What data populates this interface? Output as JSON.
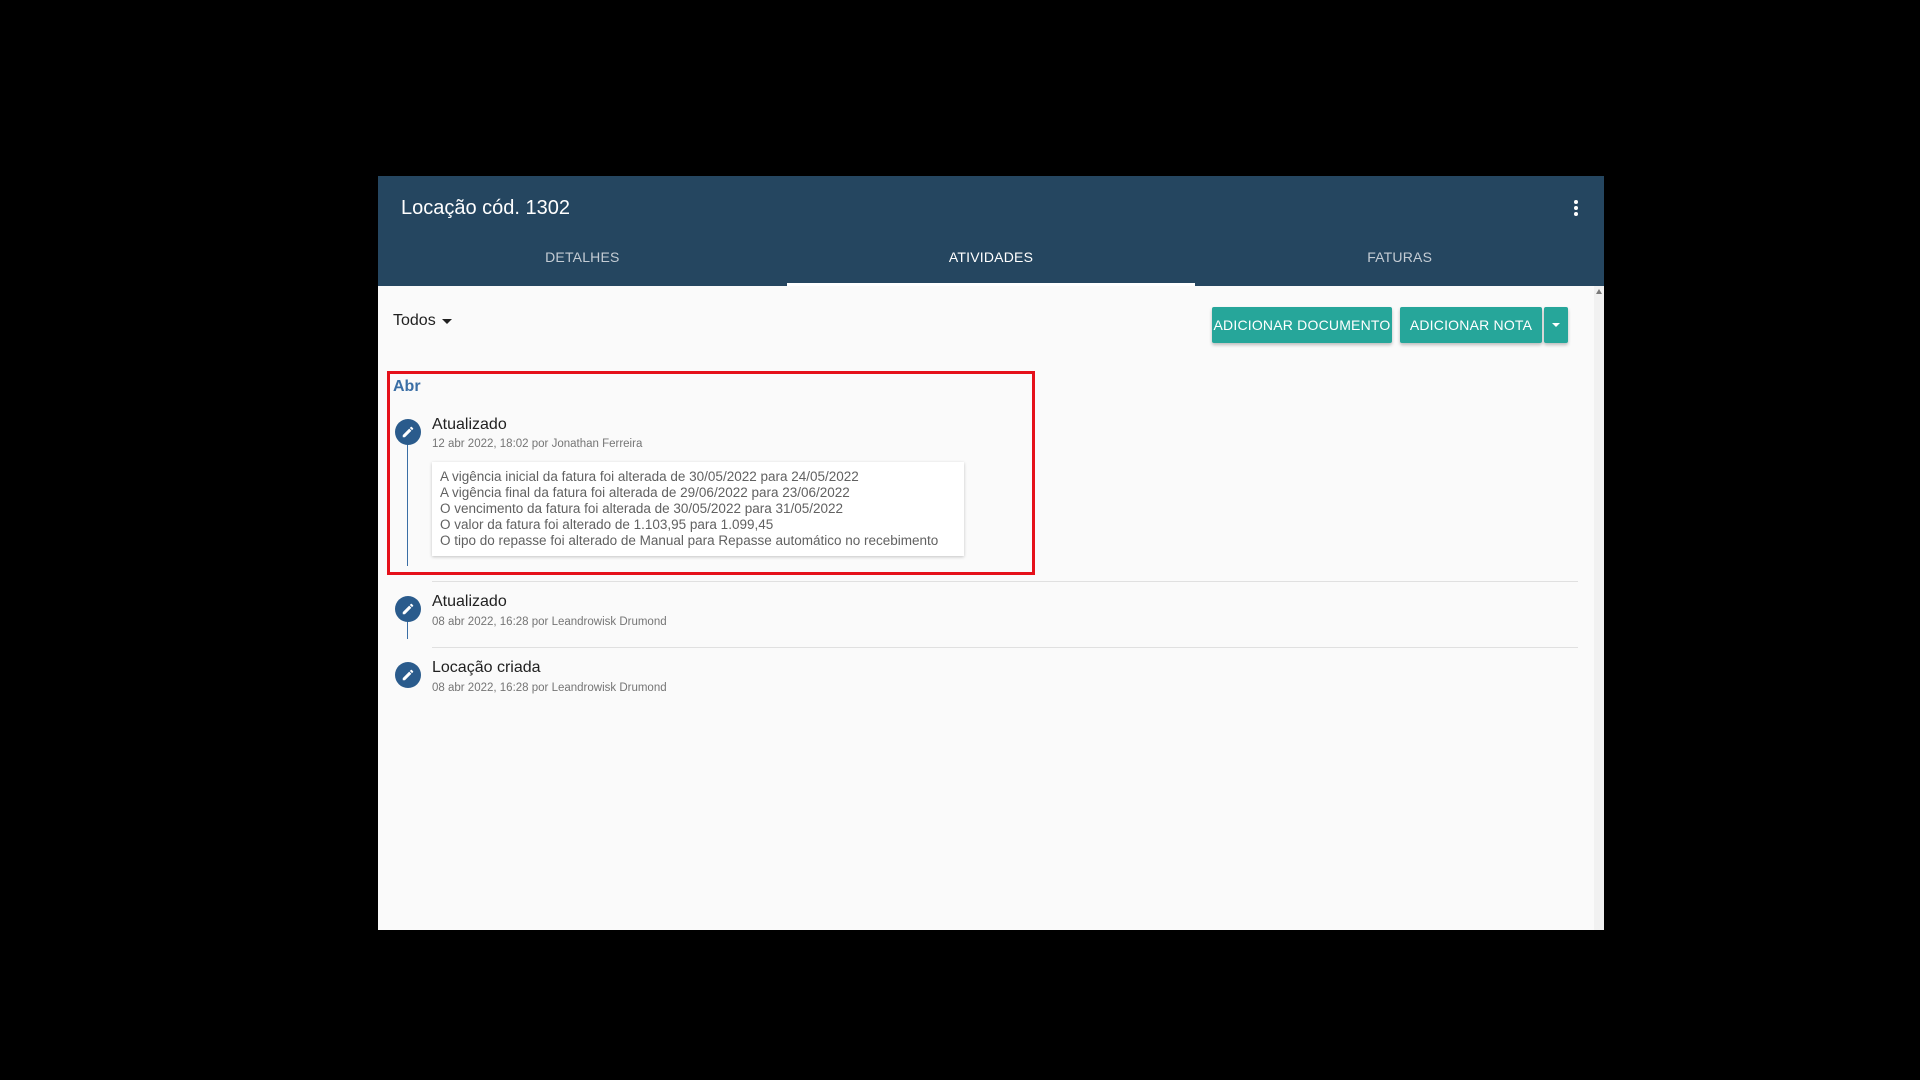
{
  "header": {
    "title": "Locação cód. 1302",
    "menu_icon": "more-vert-icon"
  },
  "tabs": [
    {
      "label": "DETALHES",
      "active": false
    },
    {
      "label": "ATIVIDADES",
      "active": true
    },
    {
      "label": "FATURAS",
      "active": false
    }
  ],
  "toolbar": {
    "filter_label": "Todos",
    "add_document_label": "ADICIONAR DOCUMENTO",
    "add_note_label": "ADICIONAR NOTA"
  },
  "timeline": {
    "month": "Abr",
    "activities": [
      {
        "title": "Atualizado",
        "meta": "12 abr 2022, 18:02 por Jonathan Ferreira",
        "icon": "edit-pencil-icon",
        "details": [
          "A vigência inicial da fatura foi alterada de 30/05/2022 para 24/05/2022",
          "A vigência final da fatura foi alterada de 29/06/2022 para 23/06/2022",
          "O vencimento da fatura foi alterada de 30/05/2022 para 31/05/2022",
          "O valor da fatura foi alterado de 1.103,95 para 1.099,45",
          "O tipo do repasse foi alterado de Manual para Repasse automático no recebimento"
        ]
      },
      {
        "title": "Atualizado",
        "meta": "08 abr 2022, 16:28 por Leandrowisk Drumond",
        "icon": "edit-pencil-icon"
      },
      {
        "title": "Locação criada",
        "meta": "08 abr 2022, 16:28 por Leandrowisk Drumond",
        "icon": "edit-pencil-icon"
      }
    ]
  },
  "colors": {
    "header_bg": "#254660",
    "accent_button": "#26a69a",
    "timeline_icon": "#2a5b8c",
    "highlight_box": "#e5101a"
  }
}
